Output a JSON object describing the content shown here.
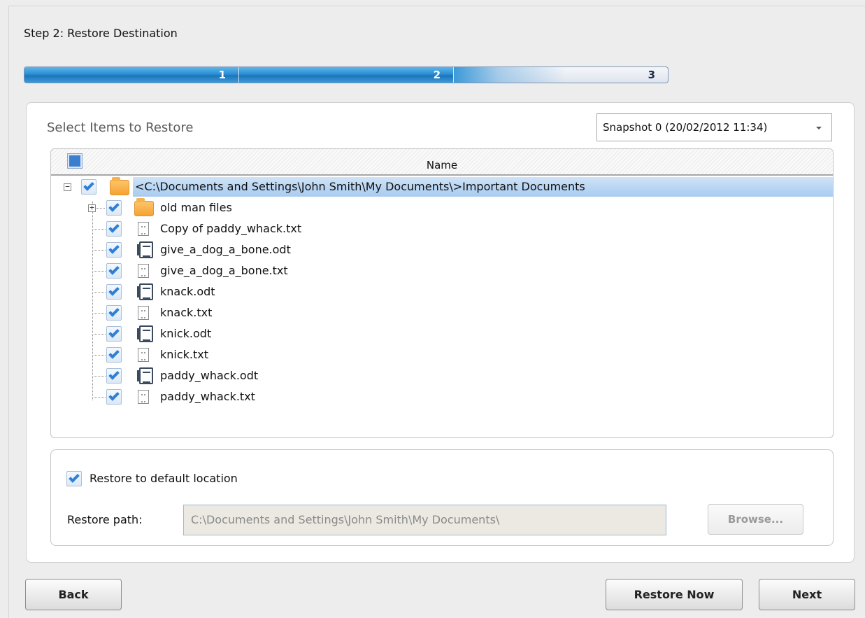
{
  "header": {
    "step_title": "Step 2: Restore Destination"
  },
  "progress": {
    "steps": [
      "1",
      "2",
      "3"
    ],
    "current_step": 2
  },
  "selection": {
    "title": "Select Items to Restore",
    "snapshot_value": "Snapshot 0 (20/02/2012 11:34)"
  },
  "tree": {
    "column_name": "Name",
    "root": {
      "label": "<C:\\Documents and Settings\\John Smith\\My Documents\\>Important Documents",
      "checked": true,
      "expanded": true
    },
    "children": [
      {
        "label": "old man files",
        "type": "folder",
        "checked": true
      },
      {
        "label": "Copy of paddy_whack.txt",
        "type": "txt",
        "checked": true
      },
      {
        "label": "give_a_dog_a_bone.odt",
        "type": "odt",
        "checked": true
      },
      {
        "label": "give_a_dog_a_bone.txt",
        "type": "txt",
        "checked": true
      },
      {
        "label": "knack.odt",
        "type": "odt",
        "checked": true
      },
      {
        "label": "knack.txt",
        "type": "txt",
        "checked": true
      },
      {
        "label": "knick.odt",
        "type": "odt",
        "checked": true
      },
      {
        "label": "knick.txt",
        "type": "txt",
        "checked": true
      },
      {
        "label": "paddy_whack.odt",
        "type": "odt",
        "checked": true
      },
      {
        "label": "paddy_whack.txt",
        "type": "txt",
        "checked": true
      }
    ]
  },
  "destination": {
    "default_location_label": "Restore to default location",
    "default_location_checked": true,
    "path_label": "Restore path:",
    "path_value": "C:\\Documents and Settings\\John Smith\\My Documents\\",
    "browse_label": "Browse..."
  },
  "buttons": {
    "back": "Back",
    "restore_now": "Restore Now",
    "next": "Next"
  }
}
